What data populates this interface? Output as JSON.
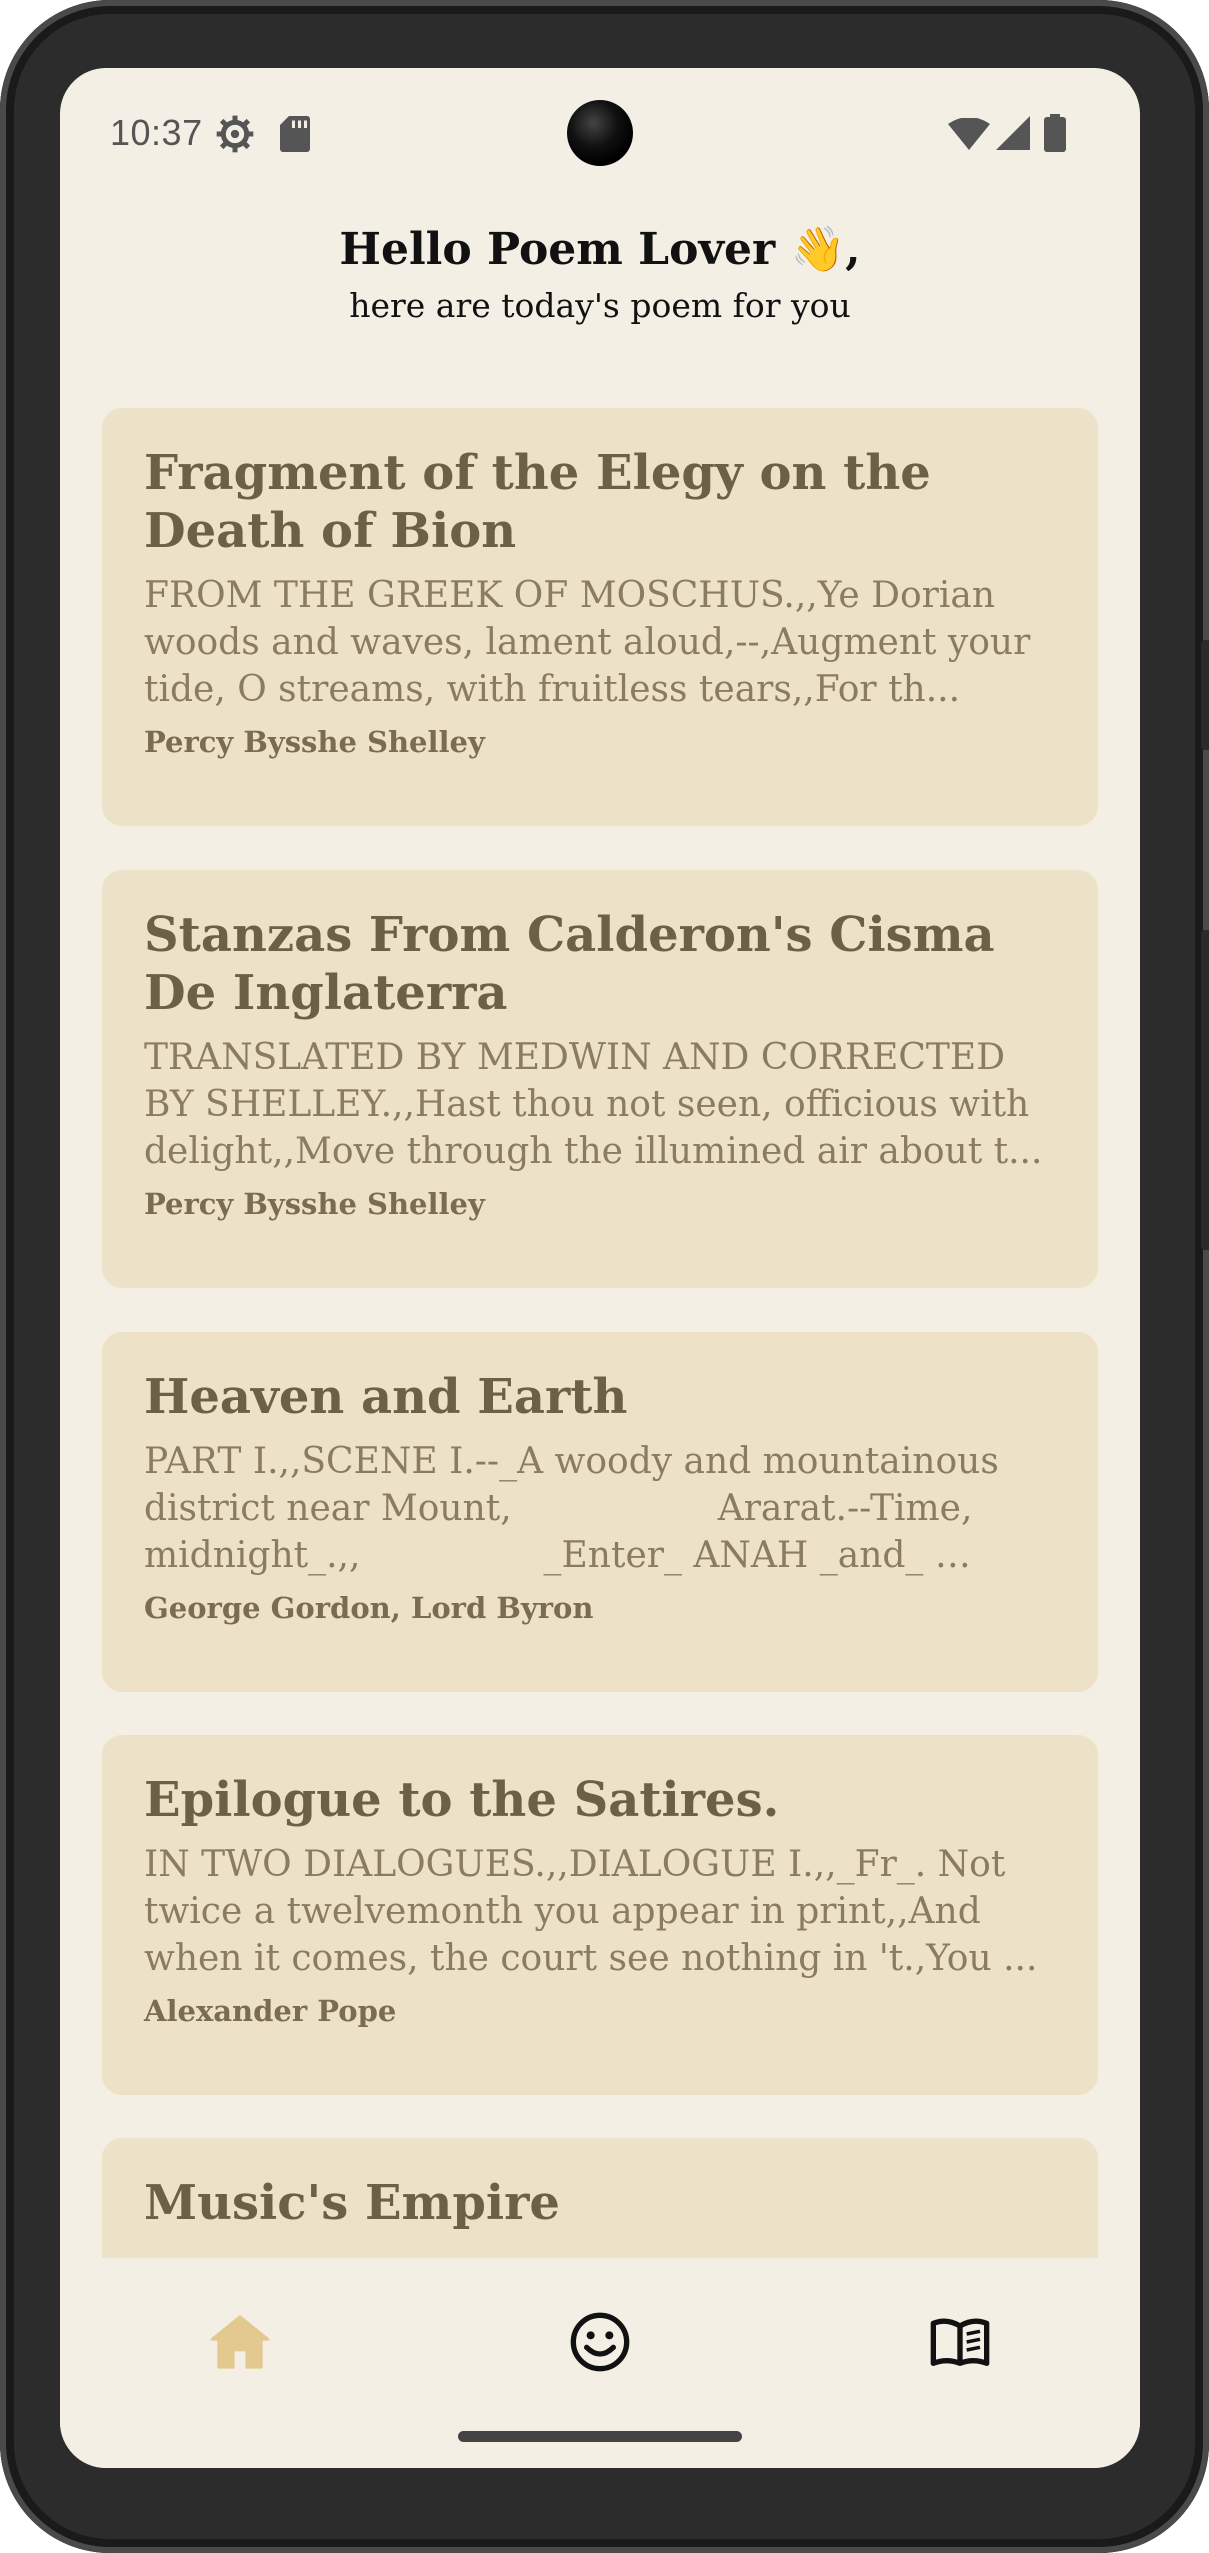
{
  "status_bar": {
    "time": "10:37",
    "left_icons": [
      "settings-gear-icon",
      "sd-card-icon"
    ],
    "right_icons": [
      "wifi-icon",
      "signal-icon",
      "battery-icon"
    ]
  },
  "header": {
    "greeting": "Hello Poem Lover 👋,",
    "subtitle": "here are today's poem for you"
  },
  "poems": [
    {
      "title": "Fragment of the Elegy on the Death of Bion",
      "excerpt": "FROM THE GREEK OF MOSCHUS.,,Ye Dorian woods and waves, lament aloud,--,Augment your tide, O streams, with fruitless tears,,For th...",
      "author": "Percy Bysshe Shelley"
    },
    {
      "title": "Stanzas From Calderon's Cisma De Inglaterra",
      "excerpt": "TRANSLATED BY MEDWIN AND CORRECTED BY SHELLEY.,,Hast thou not seen, officious with delight,,Move through the illumined air about t...",
      "author": "Percy Bysshe Shelley"
    },
    {
      "title": "Heaven and Earth",
      "excerpt": "PART I.,,SCENE I.--_A woody and mountainous district near Mount,                  Ararat.--Time, midnight_.,,                _Enter_ ANAH _and_ AHOL...",
      "author": "George Gordon, Lord Byron"
    },
    {
      "title": "Epilogue to the Satires.",
      "excerpt": "IN TWO DIALOGUES.,,DIALOGUE I.,,_Fr_. Not twice a twelvemonth you appear in print,,And when it comes, the court see nothing in 't.,You ...",
      "author": "Alexander Pope"
    },
    {
      "title": "Music's Empire",
      "excerpt": "",
      "author": ""
    }
  ],
  "bottom_nav": [
    {
      "icon": "home-icon",
      "active": true
    },
    {
      "icon": "smiley-icon",
      "active": false
    },
    {
      "icon": "book-icon",
      "active": false
    }
  ],
  "colors": {
    "background": "#f4efe4",
    "card": "#ede2c8",
    "title_text": "#6d6048",
    "body_text": "#8a7c62",
    "active_nav": "#e3c88f"
  }
}
